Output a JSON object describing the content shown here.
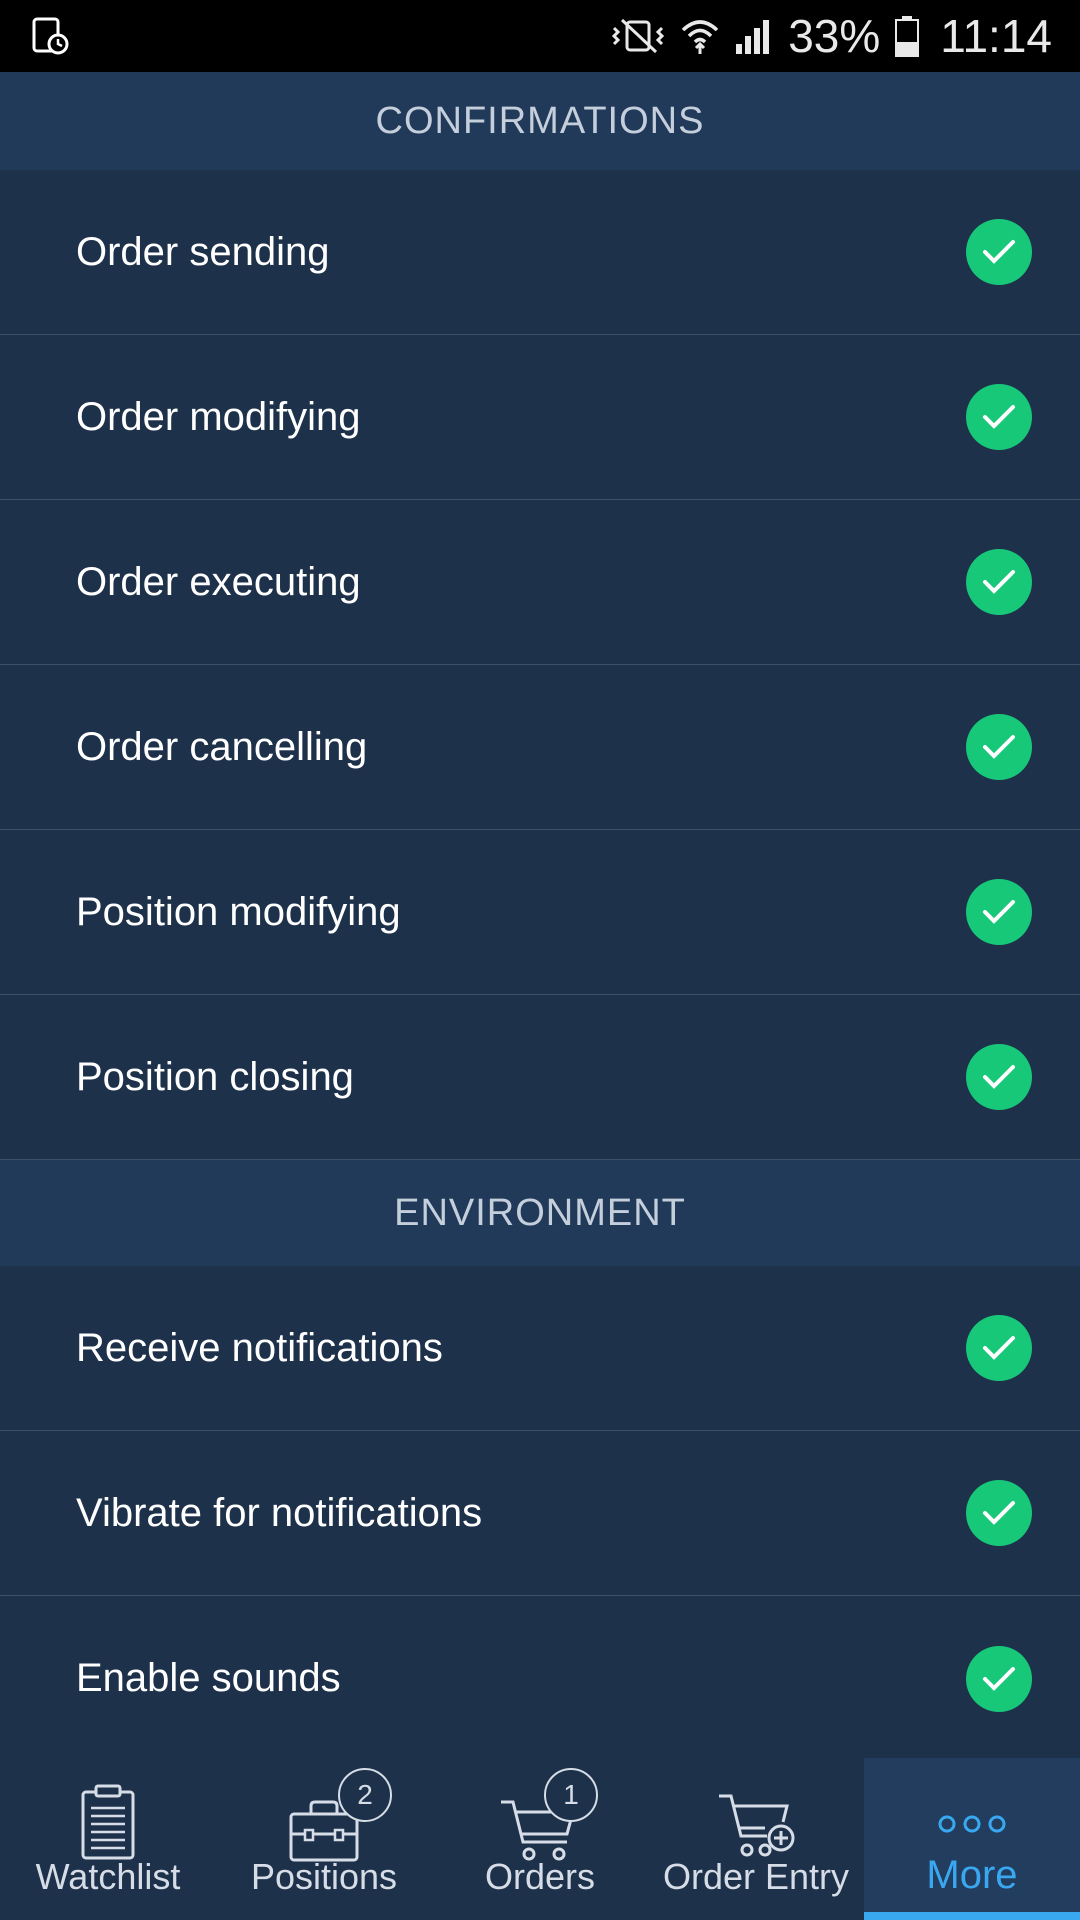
{
  "status_bar": {
    "battery": "33%",
    "time": "11:14",
    "icons": [
      "screen-timeout-icon",
      "vibrate-off-icon",
      "wifi-icon",
      "signal-icon",
      "battery-icon"
    ]
  },
  "sections": [
    {
      "title": "CONFIRMATIONS",
      "items": [
        {
          "label": "Order sending",
          "checked": true
        },
        {
          "label": "Order modifying",
          "checked": true
        },
        {
          "label": "Order executing",
          "checked": true
        },
        {
          "label": "Order cancelling",
          "checked": true
        },
        {
          "label": "Position modifying",
          "checked": true
        },
        {
          "label": "Position closing",
          "checked": true
        }
      ]
    },
    {
      "title": "ENVIRONMENT",
      "items": [
        {
          "label": "Receive notifications",
          "checked": true
        },
        {
          "label": "Vibrate for notifications",
          "checked": true
        },
        {
          "label": "Enable sounds",
          "checked": true
        }
      ]
    }
  ],
  "bottom_nav": {
    "items": [
      {
        "label": "Watchlist",
        "icon": "clipboard-icon"
      },
      {
        "label": "Positions",
        "icon": "briefcase-icon",
        "badge": "2"
      },
      {
        "label": "Orders",
        "icon": "cart-icon",
        "badge": "1"
      },
      {
        "label": "Order Entry",
        "icon": "cart-add-icon"
      },
      {
        "label": "More",
        "icon": "more-dots-icon",
        "active": true
      }
    ]
  },
  "colors": {
    "background": "#1e314b",
    "section_header": "#223a5a",
    "check_green": "#17c878",
    "accent_blue": "#3aa8f0"
  }
}
